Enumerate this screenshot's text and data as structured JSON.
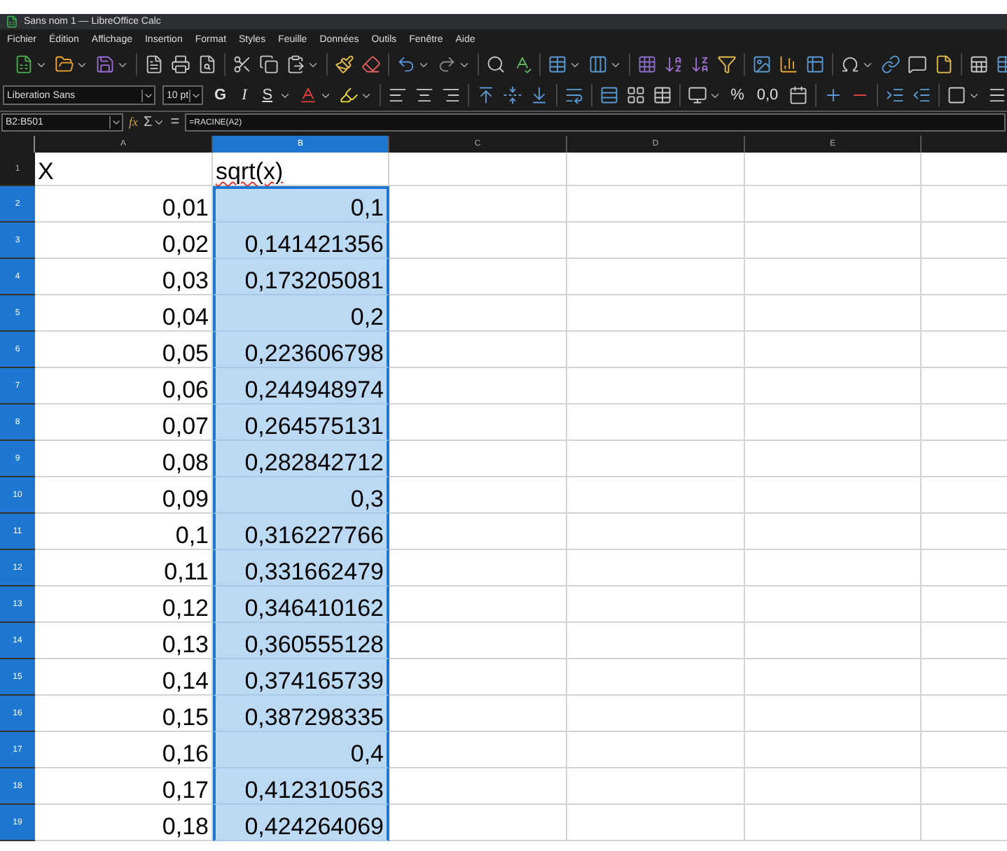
{
  "window": {
    "title": "Sans nom 1 — LibreOffice Calc"
  },
  "menu": [
    "Fichier",
    "Édition",
    "Affichage",
    "Insertion",
    "Format",
    "Styles",
    "Feuille",
    "Données",
    "Outils",
    "Fenêtre",
    "Aide"
  ],
  "format_toolbar": {
    "font_name": "Liberation Sans",
    "font_size": "10 pt",
    "style_buttons": [
      "G",
      "I",
      "S"
    ],
    "number_buttons": [
      "%",
      "0,0"
    ]
  },
  "formula_bar": {
    "name_box": "B2:B501",
    "function_wizard": "fx",
    "sum": "Σ",
    "equals": "=",
    "formula": "=RACINE(A2)"
  },
  "columns": [
    {
      "label": "A",
      "selected": false
    },
    {
      "label": "B",
      "selected": true
    },
    {
      "label": "C",
      "selected": false
    },
    {
      "label": "D",
      "selected": false
    },
    {
      "label": "E",
      "selected": false
    }
  ],
  "rows": [
    {
      "number": "1",
      "selected": false,
      "cells": [
        {
          "kind": "text",
          "text": "X",
          "selected": false,
          "spelling_error": false
        },
        {
          "kind": "text",
          "text": "sqrt(x)",
          "selected": false,
          "spelling_error": true
        }
      ]
    },
    {
      "number": "2",
      "selected": true,
      "cells": [
        {
          "kind": "number",
          "text": "0,01",
          "selected": false,
          "spelling_error": false
        },
        {
          "kind": "number",
          "text": "0,1",
          "selected": true,
          "spelling_error": false
        }
      ]
    },
    {
      "number": "3",
      "selected": true,
      "cells": [
        {
          "kind": "number",
          "text": "0,02",
          "selected": false,
          "spelling_error": false
        },
        {
          "kind": "number",
          "text": "0,141421356",
          "selected": true,
          "spelling_error": false
        }
      ]
    },
    {
      "number": "4",
      "selected": true,
      "cells": [
        {
          "kind": "number",
          "text": "0,03",
          "selected": false,
          "spelling_error": false
        },
        {
          "kind": "number",
          "text": "0,173205081",
          "selected": true,
          "spelling_error": false
        }
      ]
    },
    {
      "number": "5",
      "selected": true,
      "cells": [
        {
          "kind": "number",
          "text": "0,04",
          "selected": false,
          "spelling_error": false
        },
        {
          "kind": "number",
          "text": "0,2",
          "selected": true,
          "spelling_error": false
        }
      ]
    },
    {
      "number": "6",
      "selected": true,
      "cells": [
        {
          "kind": "number",
          "text": "0,05",
          "selected": false,
          "spelling_error": false
        },
        {
          "kind": "number",
          "text": "0,223606798",
          "selected": true,
          "spelling_error": false
        }
      ]
    },
    {
      "number": "7",
      "selected": true,
      "cells": [
        {
          "kind": "number",
          "text": "0,06",
          "selected": false,
          "spelling_error": false
        },
        {
          "kind": "number",
          "text": "0,244948974",
          "selected": true,
          "spelling_error": false
        }
      ]
    },
    {
      "number": "8",
      "selected": true,
      "cells": [
        {
          "kind": "number",
          "text": "0,07",
          "selected": false,
          "spelling_error": false
        },
        {
          "kind": "number",
          "text": "0,264575131",
          "selected": true,
          "spelling_error": false
        }
      ]
    },
    {
      "number": "9",
      "selected": true,
      "cells": [
        {
          "kind": "number",
          "text": "0,08",
          "selected": false,
          "spelling_error": false
        },
        {
          "kind": "number",
          "text": "0,282842712",
          "selected": true,
          "spelling_error": false
        }
      ]
    },
    {
      "number": "10",
      "selected": true,
      "cells": [
        {
          "kind": "number",
          "text": "0,09",
          "selected": false,
          "spelling_error": false
        },
        {
          "kind": "number",
          "text": "0,3",
          "selected": true,
          "spelling_error": false
        }
      ]
    },
    {
      "number": "11",
      "selected": true,
      "cells": [
        {
          "kind": "number",
          "text": "0,1",
          "selected": false,
          "spelling_error": false
        },
        {
          "kind": "number",
          "text": "0,316227766",
          "selected": true,
          "spelling_error": false
        }
      ]
    },
    {
      "number": "12",
      "selected": true,
      "cells": [
        {
          "kind": "number",
          "text": "0,11",
          "selected": false,
          "spelling_error": false
        },
        {
          "kind": "number",
          "text": "0,331662479",
          "selected": true,
          "spelling_error": false
        }
      ]
    },
    {
      "number": "13",
      "selected": true,
      "cells": [
        {
          "kind": "number",
          "text": "0,12",
          "selected": false,
          "spelling_error": false
        },
        {
          "kind": "number",
          "text": "0,346410162",
          "selected": true,
          "spelling_error": false
        }
      ]
    },
    {
      "number": "14",
      "selected": true,
      "cells": [
        {
          "kind": "number",
          "text": "0,13",
          "selected": false,
          "spelling_error": false
        },
        {
          "kind": "number",
          "text": "0,360555128",
          "selected": true,
          "spelling_error": false
        }
      ]
    },
    {
      "number": "15",
      "selected": true,
      "cells": [
        {
          "kind": "number",
          "text": "0,14",
          "selected": false,
          "spelling_error": false
        },
        {
          "kind": "number",
          "text": "0,374165739",
          "selected": true,
          "spelling_error": false
        }
      ]
    },
    {
      "number": "16",
      "selected": true,
      "cells": [
        {
          "kind": "number",
          "text": "0,15",
          "selected": false,
          "spelling_error": false
        },
        {
          "kind": "number",
          "text": "0,387298335",
          "selected": true,
          "spelling_error": false
        }
      ]
    },
    {
      "number": "17",
      "selected": true,
      "cells": [
        {
          "kind": "number",
          "text": "0,16",
          "selected": false,
          "spelling_error": false
        },
        {
          "kind": "number",
          "text": "0,4",
          "selected": true,
          "spelling_error": false
        }
      ]
    },
    {
      "number": "18",
      "selected": true,
      "cells": [
        {
          "kind": "number",
          "text": "0,17",
          "selected": false,
          "spelling_error": false
        },
        {
          "kind": "number",
          "text": "0,412310563",
          "selected": true,
          "spelling_error": false
        }
      ]
    },
    {
      "number": "19",
      "selected": true,
      "cells": [
        {
          "kind": "number",
          "text": "0,18",
          "selected": false,
          "spelling_error": false
        },
        {
          "kind": "number",
          "text": "0,424264069",
          "selected": true,
          "spelling_error": false
        }
      ]
    }
  ]
}
